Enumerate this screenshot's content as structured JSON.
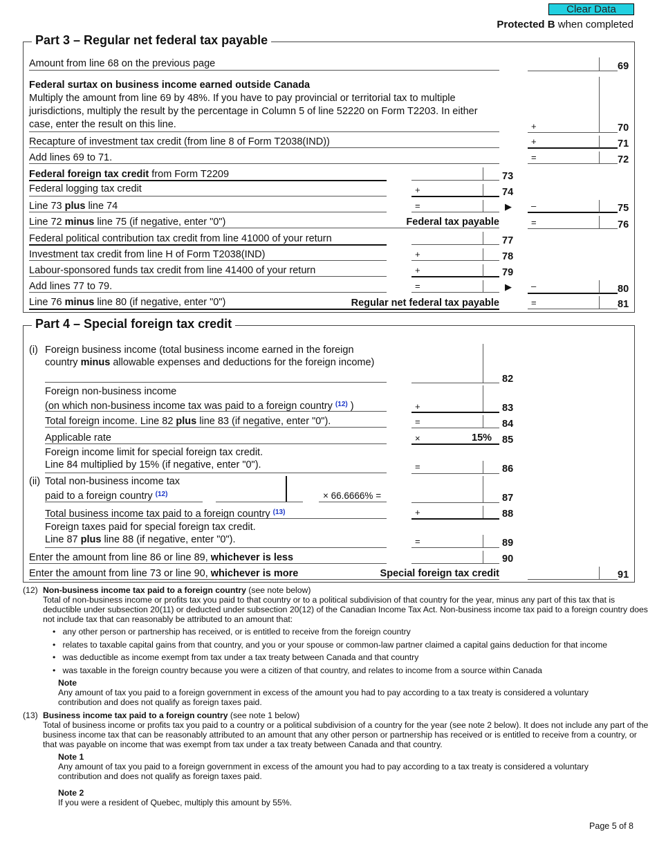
{
  "header": {
    "clear_button": "Clear Data",
    "protected_bold": "Protected B",
    "protected_rest": " when completed"
  },
  "part3": {
    "title": "Part 3 – Regular net federal tax payable",
    "line69": {
      "text": "Amount from line 68 on the previous page",
      "num": "69"
    },
    "line70": {
      "heading": "Federal surtax on business income earned outside Canada",
      "text": "Multiply the amount from line 69 by 48%. If you have to pay provincial or territorial tax to multiple jurisdictions, multiply the result by the percentage in Column 5 of line 52220 on Form T2203. In either case, enter the result on this line.",
      "op": "+",
      "num": "70"
    },
    "line71": {
      "text": "Recapture of investment tax credit (from line 8 of Form T2038(IND))",
      "op": "+",
      "num": "71"
    },
    "line72": {
      "text": "Add lines 69 to 71.",
      "op": "=",
      "num": "72"
    },
    "line73": {
      "bold": "Federal foreign tax credit",
      "text": " from Form T2209",
      "num": "73"
    },
    "line74": {
      "text": "Federal logging tax credit",
      "op": "+",
      "num": "74"
    },
    "line75": {
      "pre": "Line 73 ",
      "bold": "plus",
      "post": " line 74",
      "op": "=",
      "arrow": "▶",
      "op2": "–",
      "num": "75"
    },
    "line76": {
      "pre": "Line 72 ",
      "bold": "minus",
      "post": " line 75 (if negative, enter \"0\")",
      "label": "Federal tax payable",
      "op": "=",
      "num": "76"
    },
    "line77": {
      "text": "Federal political contribution tax credit from line 41000 of your return",
      "num": "77"
    },
    "line78": {
      "text": "Investment tax credit from line H of Form T2038(IND)",
      "op": "+",
      "num": "78"
    },
    "line79": {
      "text": "Labour-sponsored funds tax credit from line 41400 of your return",
      "op": "+",
      "num": "79"
    },
    "line80": {
      "text": "Add lines 77 to 79.",
      "op": "=",
      "arrow": "▶",
      "op2": "–",
      "num": "80"
    },
    "line81": {
      "pre": "Line 76 ",
      "bold": "minus",
      "post": " line 80 (if negative, enter \"0\")",
      "label": "Regular net federal tax payable",
      "op": "=",
      "num": "81"
    }
  },
  "part4": {
    "title": "Part 4 – Special foreign tax credit",
    "marker_i": "(i)",
    "marker_ii": "(ii)",
    "line82": {
      "pre": "Foreign business income (total business income earned in the foreign country ",
      "bold": "minus",
      "post": " allowable expenses and deductions for the foreign income)",
      "num": "82"
    },
    "line83": {
      "l1": "Foreign non-business income",
      "l2": "(on which non-business income tax was paid to a foreign country ",
      "fn": "(12)",
      "l2end": " )",
      "op": "+",
      "num": "83"
    },
    "line84": {
      "pre": "Total foreign income. Line 82 ",
      "bold": "plus",
      "post": " line 83 (if negative, enter \"0\").",
      "op": "=",
      "num": "84"
    },
    "line85": {
      "text": "Applicable rate",
      "op": "×",
      "value": "15%",
      "num": "85"
    },
    "line86": {
      "l1": "Foreign income limit for special foreign tax credit.",
      "l2": "Line 84 multiplied by 15% (if negative, enter \"0\").",
      "op": "=",
      "num": "86"
    },
    "line87": {
      "l1": "Total non-business income tax",
      "l2": "paid to a foreign country ",
      "fn": "(12)",
      "mult": "× 66.6666% =",
      "num": "87"
    },
    "line88": {
      "text": "Total business income tax paid to a foreign country ",
      "fn": "(13)",
      "op": "+",
      "num": "88"
    },
    "line89": {
      "l1": "Foreign taxes paid for special foreign tax credit.",
      "l2pre": "Line 87 ",
      "l2bold": "plus",
      "l2post": " line 88 (if negative, enter \"0\").",
      "op": "=",
      "num": "89"
    },
    "line90": {
      "pre": "Enter the amount from line 86 or line 89, ",
      "bold": "whichever is less",
      "num": "90"
    },
    "line91": {
      "pre": "Enter the amount from line 73 or line 90, ",
      "bold": "whichever is more",
      "label": "Special foreign tax credit",
      "num": "91"
    }
  },
  "notes": {
    "n12": {
      "num": "(12)",
      "heading": "Non-business income tax paid to a foreign country",
      "heading_suffix": " (see note below)",
      "body": "Total of non-business income or profits tax you paid to that country or to a political subdivision of that country for the year, minus any part of this tax that is deductible under subsection 20(11) or deducted under subsection 20(12) of the Canadian Income Tax Act. Non-business income tax paid to a foreign country does not include tax that can reasonably be attributed to an amount that:",
      "bullets": [
        "any other person or partnership has received, or is entitled to receive from the foreign country",
        "relates to taxable capital gains from that country, and you or your spouse or common-law partner claimed a capital gains deduction for that income",
        "was deductible as income exempt from tax under a tax treaty between Canada and that country",
        "was taxable in the foreign country because you were a citizen of that country, and relates to income from a source within Canada"
      ],
      "note_title": "Note",
      "note_body": "Any amount of tax you paid to a foreign government in excess of the amount you had to pay according to a tax treaty is considered a voluntary contribution and does not qualify as foreign taxes paid."
    },
    "n13": {
      "num": "(13)",
      "heading": "Business income tax paid to a foreign country",
      "heading_suffix": " (see note 1 below)",
      "body": "Total of business income or profits tax you paid to a country or a political subdivision of a country for the year (see note 2 below). It does not include any part of the business income tax that can be reasonably attributed to an amount that any other person or partnership has received or is entitled to receive from a country, or that was payable on income that was exempt from tax under a tax treaty between Canada and that country.",
      "note1_title": "Note 1",
      "note1_body": "Any amount of tax you paid to a foreign government in excess of the amount you had to pay according to a tax treaty is considered a voluntary contribution and does not qualify as foreign taxes paid.",
      "note2_title": "Note 2",
      "note2_body": "If you were a resident of Quebec, multiply this amount by 55%."
    }
  },
  "footer": {
    "page": "Page 5 of 8"
  }
}
